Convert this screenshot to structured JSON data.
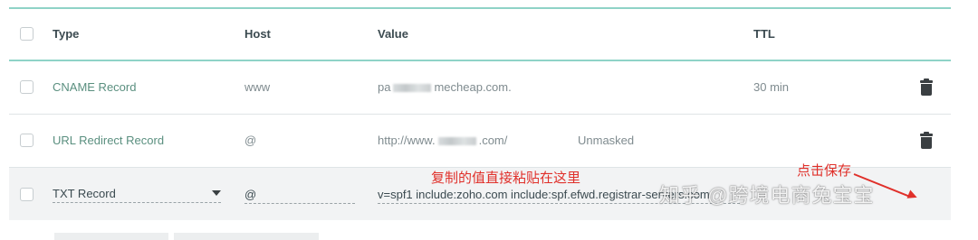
{
  "header": {
    "type": "Type",
    "host": "Host",
    "value": "Value",
    "ttl": "TTL"
  },
  "rows": [
    {
      "type": "CNAME Record",
      "host": "www",
      "value_prefix": "pa",
      "value_suffix": "mecheap.com.",
      "ttl": "30 min"
    },
    {
      "type": "URL Redirect Record",
      "host": "@",
      "value_prefix": "http://www.",
      "value_suffix": ".com/",
      "extra": "Unmasked"
    }
  ],
  "edit_row": {
    "type": "TXT Record",
    "host": "@",
    "value": "v=spf1 include:zoho.com include:spf.efwd.registrar-servers.com"
  },
  "annotations": {
    "paste_here": "复制的值直接粘贴在这里",
    "click_save": "点击保存"
  },
  "watermark": "知乎 @跨境电商兔宝宝",
  "colors": {
    "accent_rule": "#8fd3c7",
    "annotation": "#e0302a",
    "type_text": "#5a8f7f"
  }
}
